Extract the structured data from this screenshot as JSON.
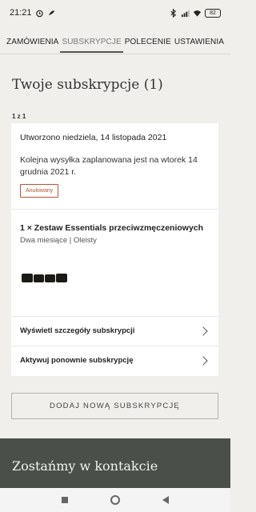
{
  "status_bar": {
    "time": "21:21",
    "battery": "82"
  },
  "tabs": [
    {
      "label": "ZAMÓWIENIA",
      "active": false
    },
    {
      "label": "SUBSKRYPCJE",
      "active": true
    },
    {
      "label": "POLECENIE",
      "active": false
    },
    {
      "label": "USTAWIENIA",
      "active": false
    }
  ],
  "page": {
    "title": "Twoje subskrypcje (1)",
    "count": "1 z 1"
  },
  "subscription": {
    "created": "Utworzono niedziela, 14 listopada 2021",
    "next_shipment": "Kolejna wysyłka zaplanowana jest na wtorek 14 grudnia 2021 r.",
    "status_badge": "Anulowany",
    "product_title": "1 × Zestaw Essentials przeciwzmęczeniowych",
    "product_details": "Dwa miesiące | Oleisty",
    "actions": [
      {
        "label": "Wyświetl szczegóły subskrypcji"
      },
      {
        "label": "Aktywuj ponownie subskrypcję"
      }
    ]
  },
  "add_button": "DODAJ NOWĄ SUBSKRYPCJĘ",
  "footer": {
    "title": "Zostańmy w kontakcie"
  },
  "colors": {
    "background": "#f0efec",
    "footer": "#4a5049",
    "badge": "#b45533"
  }
}
